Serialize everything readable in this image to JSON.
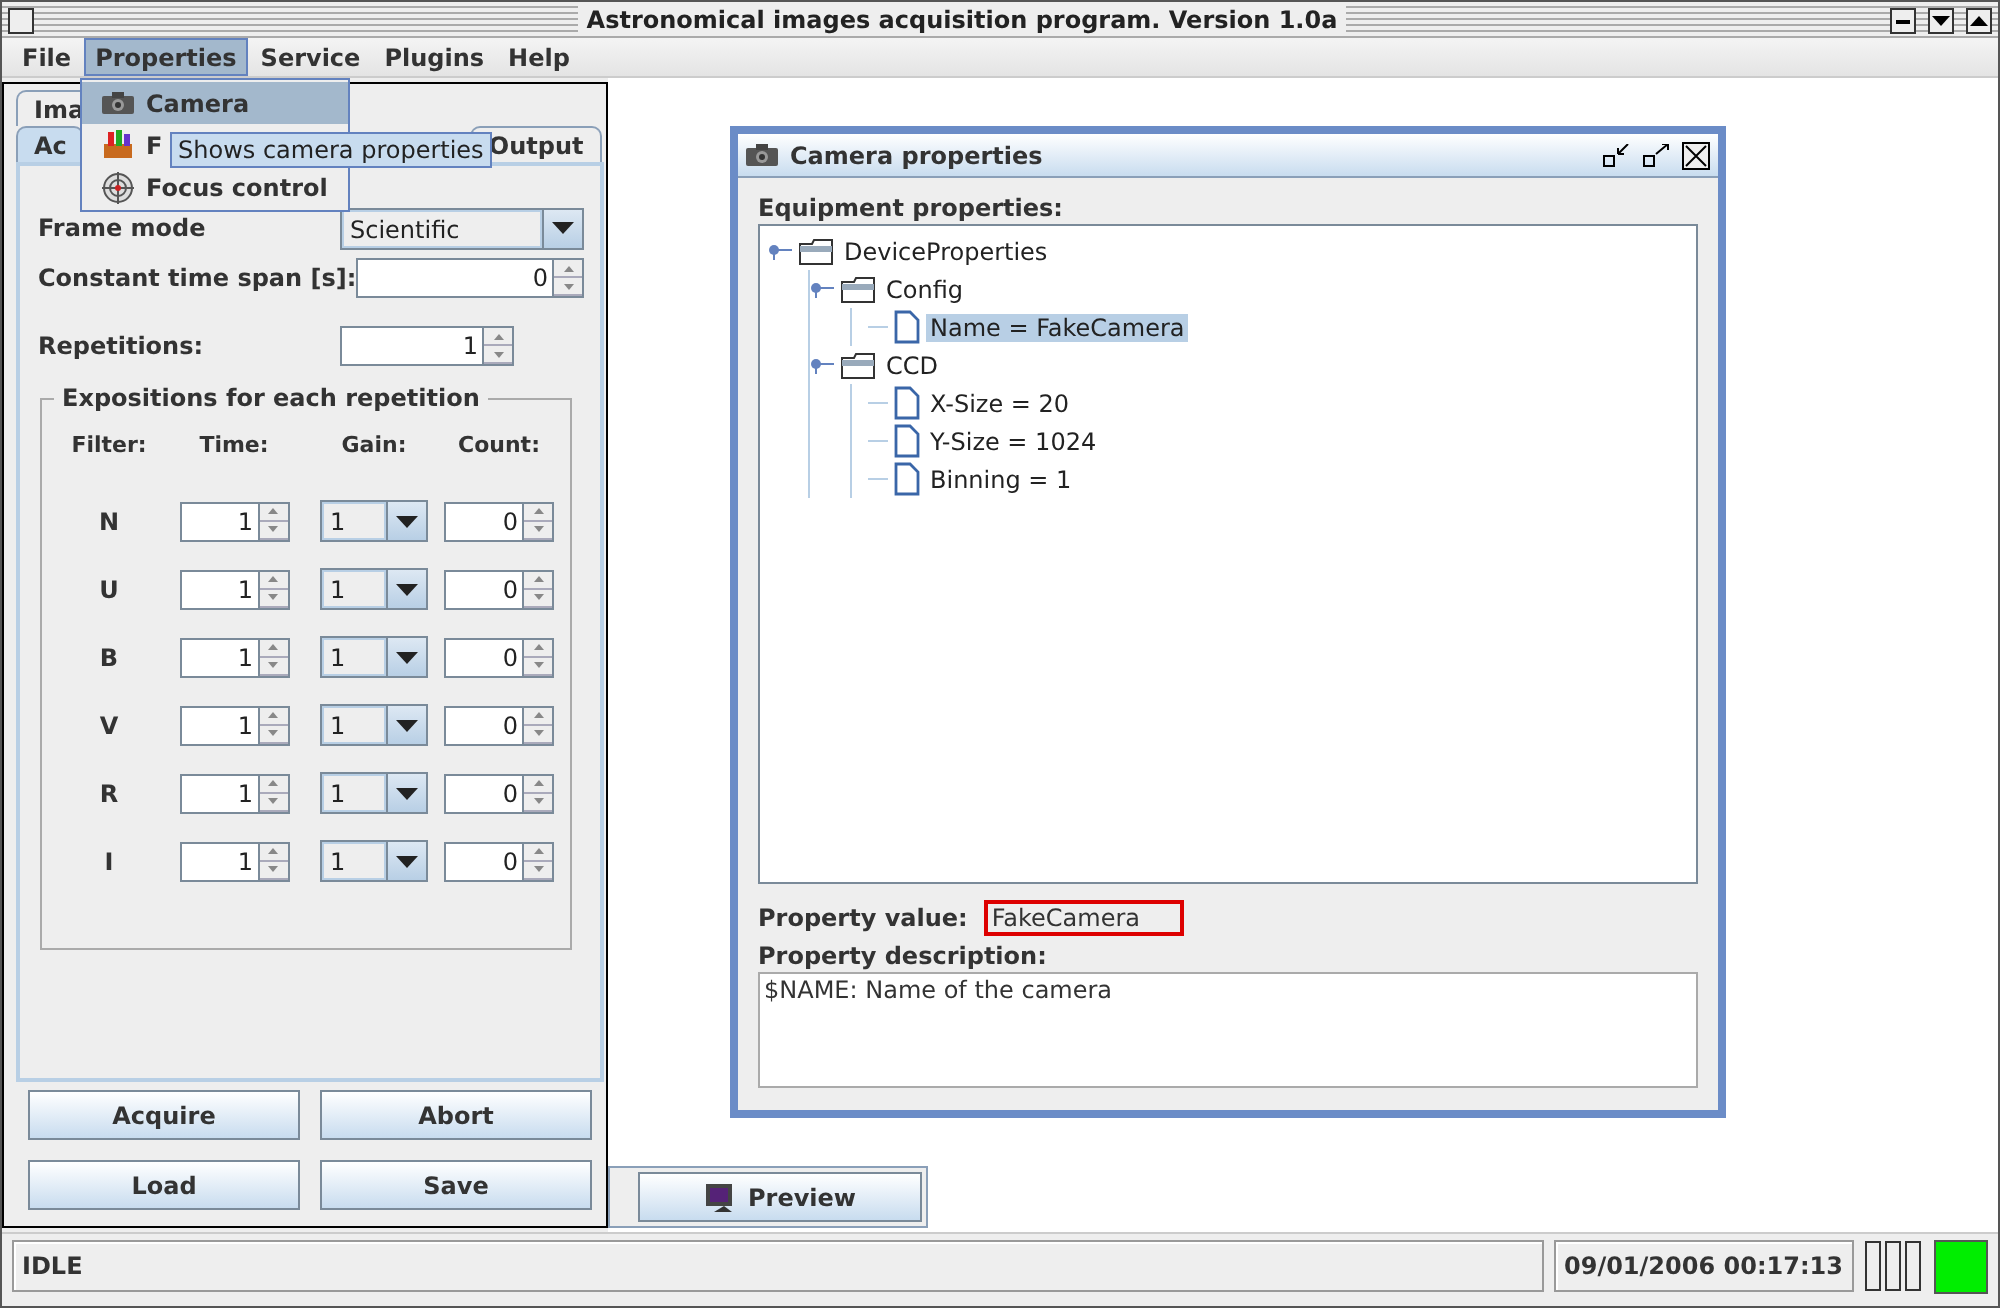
{
  "window": {
    "title": "Astronomical images acquisition program. Version 1.0a"
  },
  "menu_bar": [
    {
      "label": "File",
      "selected": false
    },
    {
      "label": "Properties",
      "selected": true
    },
    {
      "label": "Service",
      "selected": false
    },
    {
      "label": "Plugins",
      "selected": false
    },
    {
      "label": "Help",
      "selected": false
    }
  ],
  "open_menu": {
    "items": [
      {
        "label": "Camera",
        "kind": "camera",
        "selected": true
      },
      {
        "label": "F",
        "kind": "filters",
        "selected": false
      },
      {
        "label": "Focus control",
        "kind": "focus",
        "selected": false
      }
    ],
    "tooltip": "Shows camera properties"
  },
  "tabs_row1": [
    {
      "label": "Ima",
      "selected": false
    }
  ],
  "tabs_row2": [
    {
      "label": "Ac",
      "selected": true
    },
    {
      "label": "Output",
      "selected": false
    }
  ],
  "form": {
    "frame_mode": {
      "label": "Frame mode",
      "value": "Scientific"
    },
    "constant_time": {
      "label": "Constant time span [s]:",
      "value": "0"
    },
    "repetitions": {
      "label": "Repetitions:",
      "value": "1"
    }
  },
  "expositions": {
    "title": "Expositions for each repetition",
    "columns": [
      "Filter:",
      "Time:",
      "Gain:",
      "Count:"
    ],
    "rows": [
      {
        "filter": "N",
        "time": "1",
        "gain": "1",
        "count": "0"
      },
      {
        "filter": "U",
        "time": "1",
        "gain": "1",
        "count": "0"
      },
      {
        "filter": "B",
        "time": "1",
        "gain": "1",
        "count": "0"
      },
      {
        "filter": "V",
        "time": "1",
        "gain": "1",
        "count": "0"
      },
      {
        "filter": "R",
        "time": "1",
        "gain": "1",
        "count": "0"
      },
      {
        "filter": "I",
        "time": "1",
        "gain": "1",
        "count": "0"
      }
    ]
  },
  "buttons": [
    "Acquire",
    "Abort",
    "Load",
    "Save"
  ],
  "camera_dialog": {
    "title": "Camera properties",
    "tree_label": "Equipment properties:",
    "tree": [
      {
        "label": "DeviceProperties",
        "kind": "folder",
        "expanded": true,
        "selected": false,
        "children": [
          {
            "label": "Config",
            "kind": "folder",
            "expanded": true,
            "selected": false,
            "children": [
              {
                "label": "Name = FakeCamera",
                "kind": "leaf",
                "selected": true
              }
            ]
          },
          {
            "label": "CCD",
            "kind": "folder",
            "expanded": true,
            "selected": false,
            "children": [
              {
                "label": "X-Size = 20",
                "kind": "leaf",
                "selected": false
              },
              {
                "label": "Y-Size = 1024",
                "kind": "leaf",
                "selected": false
              },
              {
                "label": "Binning = 1",
                "kind": "leaf",
                "selected": false
              }
            ]
          }
        ]
      }
    ],
    "value_label": "Property value:",
    "value": "FakeCamera",
    "description_label": "Property description:",
    "description": "$NAME: Name of the camera"
  },
  "taskbar": [
    {
      "label": "Preview"
    }
  ],
  "status_bar": {
    "status": "IDLE",
    "datetime": "09/01/2006 00:17:13",
    "connected": true
  }
}
